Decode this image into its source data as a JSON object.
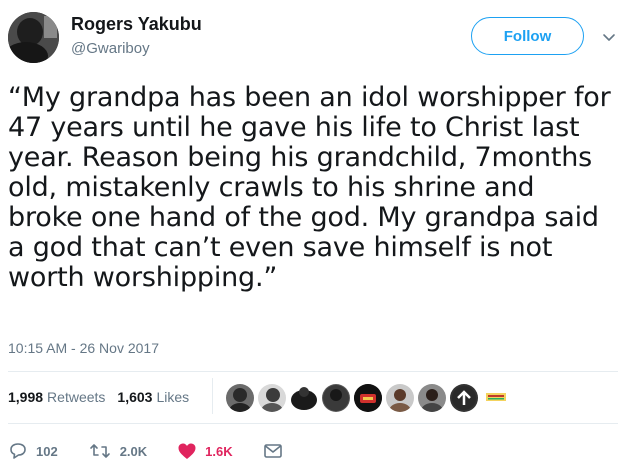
{
  "user": {
    "name": "Rogers Yakubu",
    "handle": "@Gwariboy"
  },
  "follow_button": {
    "label": "Follow"
  },
  "tweet": {
    "text": "“My grandpa has been an idol worshipper for 47 years until he gave his life to Christ last year. Reason being his grandchild, 7months old, mistakenly crawls to his shrine and broke one hand of the god. My grandpa said a god that can’t even save himself is not worth worshipping.”",
    "timestamp": "10:15 AM - 26 Nov 2017"
  },
  "stats": {
    "retweets_count": "1,998",
    "retweets_label": "Retweets",
    "likes_count": "1,603",
    "likes_label": "Likes"
  },
  "actions": {
    "reply_count": "102",
    "retweet_count": "2.0K",
    "like_count": "1.6K"
  },
  "colors": {
    "accent": "#1da1f2",
    "like": "#e0245e",
    "secondary_text": "#657786"
  }
}
